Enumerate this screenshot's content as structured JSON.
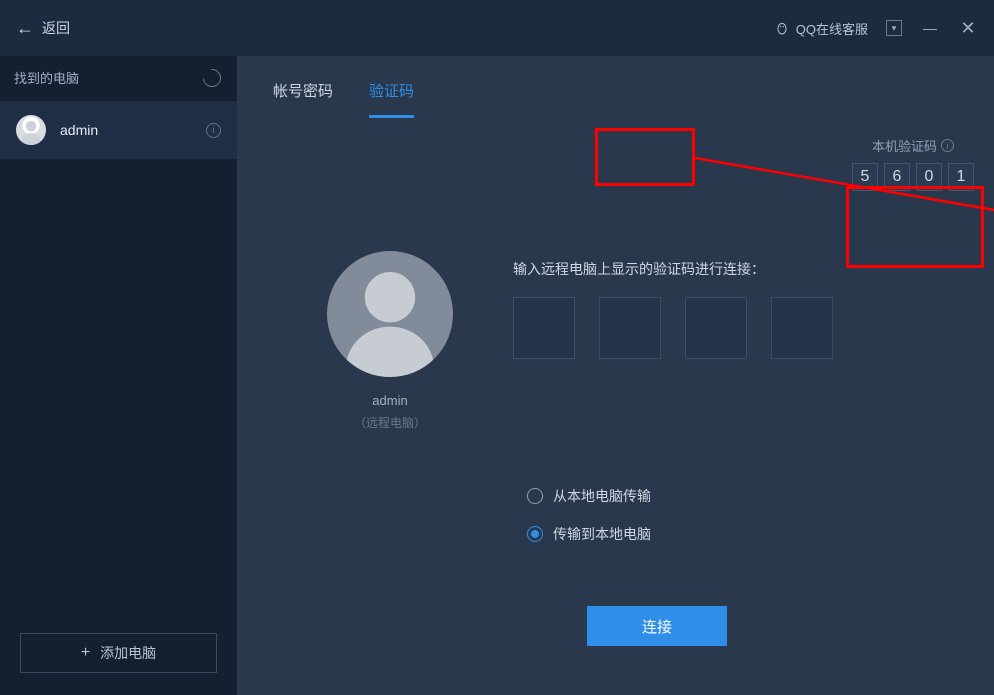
{
  "titlebar": {
    "back_label": "返回",
    "qq_service": "QQ在线客服"
  },
  "sidebar": {
    "header": "找到的电脑",
    "items": [
      {
        "name": "admin"
      }
    ],
    "add_button": "添加电脑"
  },
  "tabs": [
    {
      "label": "帐号密码",
      "active": false
    },
    {
      "label": "验证码",
      "active": true
    }
  ],
  "local_code": {
    "label": "本机验证码",
    "digits": [
      "5",
      "6",
      "0",
      "1"
    ]
  },
  "remote": {
    "name": "admin",
    "sub": "（远程电脑）"
  },
  "input": {
    "label": "输入远程电脑上显示的验证码进行连接：",
    "values": [
      "",
      "",
      "",
      ""
    ]
  },
  "transfer": {
    "option_from_local": "从本地电脑传输",
    "option_to_local": "传输到本地电脑",
    "selected": "to_local"
  },
  "connect_button": "连接"
}
